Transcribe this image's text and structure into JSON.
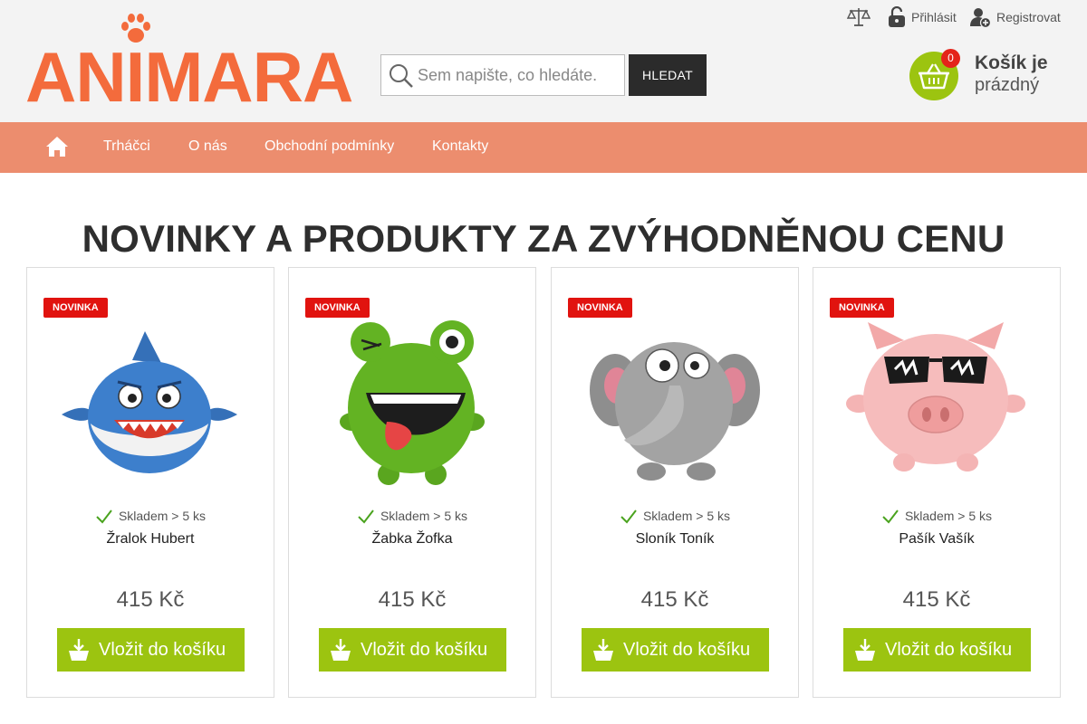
{
  "logo": {
    "text": "ANIMARA"
  },
  "search": {
    "placeholder": "Sem napište, co hledáte.",
    "button_label": "HLEDAT"
  },
  "top_links": [
    {
      "label": "",
      "icon": "compare-scales-icon"
    },
    {
      "label": "Přihlásit",
      "icon": "lock-icon"
    },
    {
      "label": "Registrovat",
      "icon": "add-user-icon"
    }
  ],
  "cart": {
    "count": "0",
    "title": "Košík je",
    "subtitle": "prázdný",
    "icon": "basket-icon"
  },
  "nav": {
    "home_icon": "home-icon",
    "items": [
      {
        "label": "Trháčci"
      },
      {
        "label": "O nás"
      },
      {
        "label": "Obchodní podmínky"
      },
      {
        "label": "Kontakty"
      }
    ]
  },
  "heading": "NOVINKY A PRODUKTY ZA ZVÝHODNĚNOU CENU",
  "products": [
    {
      "badge": "NOVINKA",
      "stock": "Skladem > 5 ks",
      "name": "Žralok Hubert",
      "price": "415 Kč",
      "button": "Vložit do košíku",
      "image": "shark-plush"
    },
    {
      "badge": "NOVINKA",
      "stock": "Skladem > 5 ks",
      "name": "Žabka Žofka",
      "price": "415 Kč",
      "button": "Vložit do košíku",
      "image": "frog-plush"
    },
    {
      "badge": "NOVINKA",
      "stock": "Skladem > 5 ks",
      "name": "Sloník Toník",
      "price": "415 Kč",
      "button": "Vložit do košíku",
      "image": "elephant-plush"
    },
    {
      "badge": "NOVINKA",
      "stock": "Skladem > 5 ks",
      "name": "Pašík Vašík",
      "price": "415 Kč",
      "button": "Vložit do košíku",
      "image": "pig-plush"
    }
  ],
  "colors": {
    "brand_orange": "#f36b3c",
    "nav_bg": "#ec8d6e",
    "green": "#9cc410",
    "badge_red": "#e1130f"
  }
}
